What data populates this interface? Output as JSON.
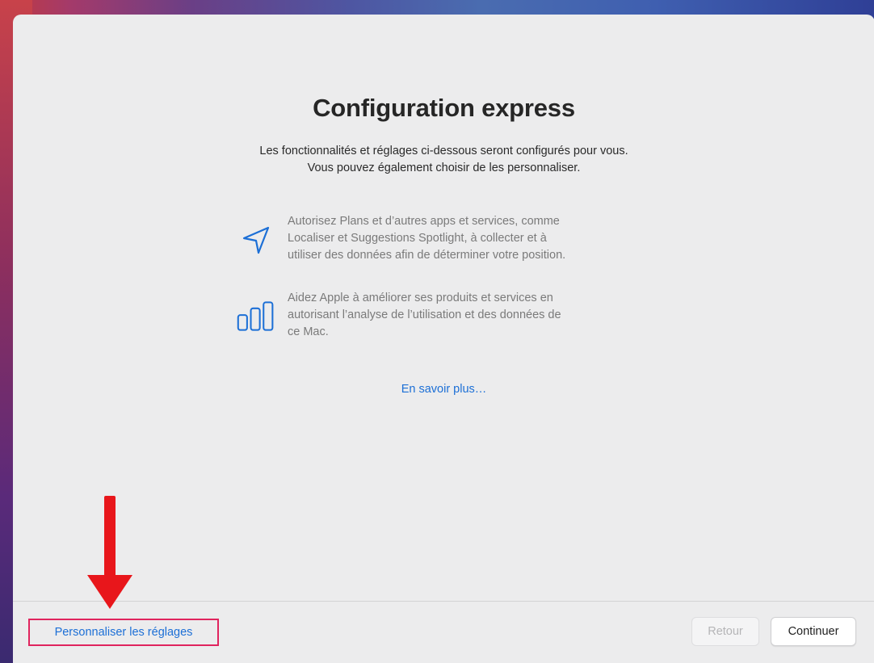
{
  "window": {
    "title": "Configuration express",
    "subtitle_lines": [
      "Les fonctionnalités et réglages ci-dessous seront configurés pour vous.",
      "Vous pouvez également choisir de les personnaliser."
    ]
  },
  "features": [
    {
      "icon": "location-arrow-icon",
      "lines": [
        "Autorisez Plans et d’autres apps et services, comme",
        "Localiser et Suggestions Spotlight, à collecter et à",
        "utiliser des données afin de déterminer votre position."
      ]
    },
    {
      "icon": "analytics-bars-icon",
      "lines": [
        "Aidez Apple à améliorer ses produits et services en",
        "autorisant l’analyse de l’utilisation et des données de",
        "ce Mac."
      ]
    }
  ],
  "learn_more": "En savoir plus…",
  "footer": {
    "customize_label": "Personnaliser les réglages",
    "back_label": "Retour",
    "continue_label": "Continuer"
  },
  "colors": {
    "accent": "#1c6fd6",
    "highlight_box": "#e0245e",
    "annotation_arrow": "#e8161b"
  }
}
